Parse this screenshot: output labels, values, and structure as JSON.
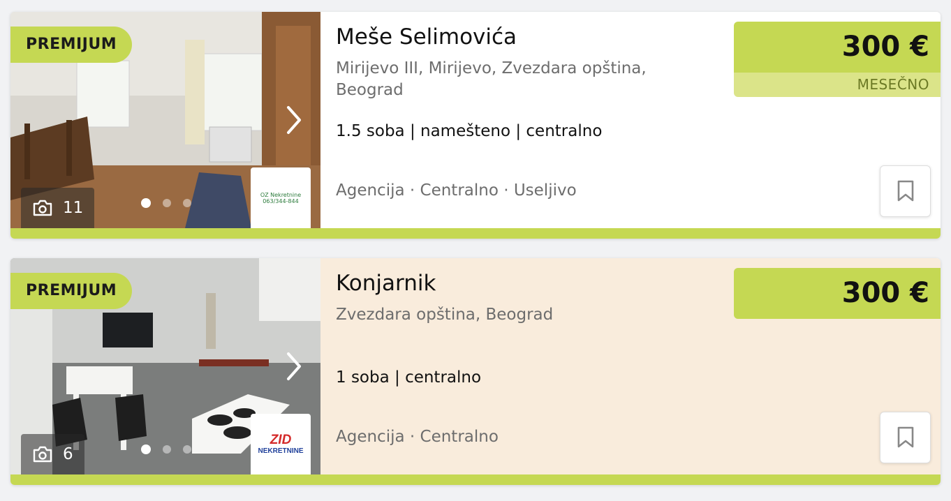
{
  "listings": [
    {
      "badge": "PREMIJUM",
      "photo_count": "11",
      "agency_logo": {
        "line1": "OZ Nekretnine",
        "line2": "063/344-844"
      },
      "title": "Meše Selimovića",
      "location": "Mirijevo III, Mirijevo, Zvezdara opština, Beograd",
      "features": "1.5 soba | namešteno | centralno",
      "tags": "Agencija · Centralno · Useljivo",
      "price": "300 €",
      "price_period": "MESEČNO",
      "carousel": {
        "total": 3,
        "active": 1
      }
    },
    {
      "badge": "PREMIJUM",
      "photo_count": "6",
      "agency_logo": {
        "line1": "ZID",
        "line2": "NEKRETNINE"
      },
      "title": "Konjarnik",
      "location": "Zvezdara opština, Beograd",
      "features": "1 soba | centralno",
      "tags": "Agencija · Centralno",
      "price": "300 €",
      "carousel": {
        "total": 3,
        "active": 1
      }
    }
  ],
  "colors": {
    "accent": "#c5d853",
    "accent_light": "#dbe489",
    "highlight_card": "#f9ecdc",
    "text_muted": "#6d6d6d"
  },
  "icons": [
    "camera-icon",
    "chevron-right-icon",
    "bookmark-icon"
  ]
}
